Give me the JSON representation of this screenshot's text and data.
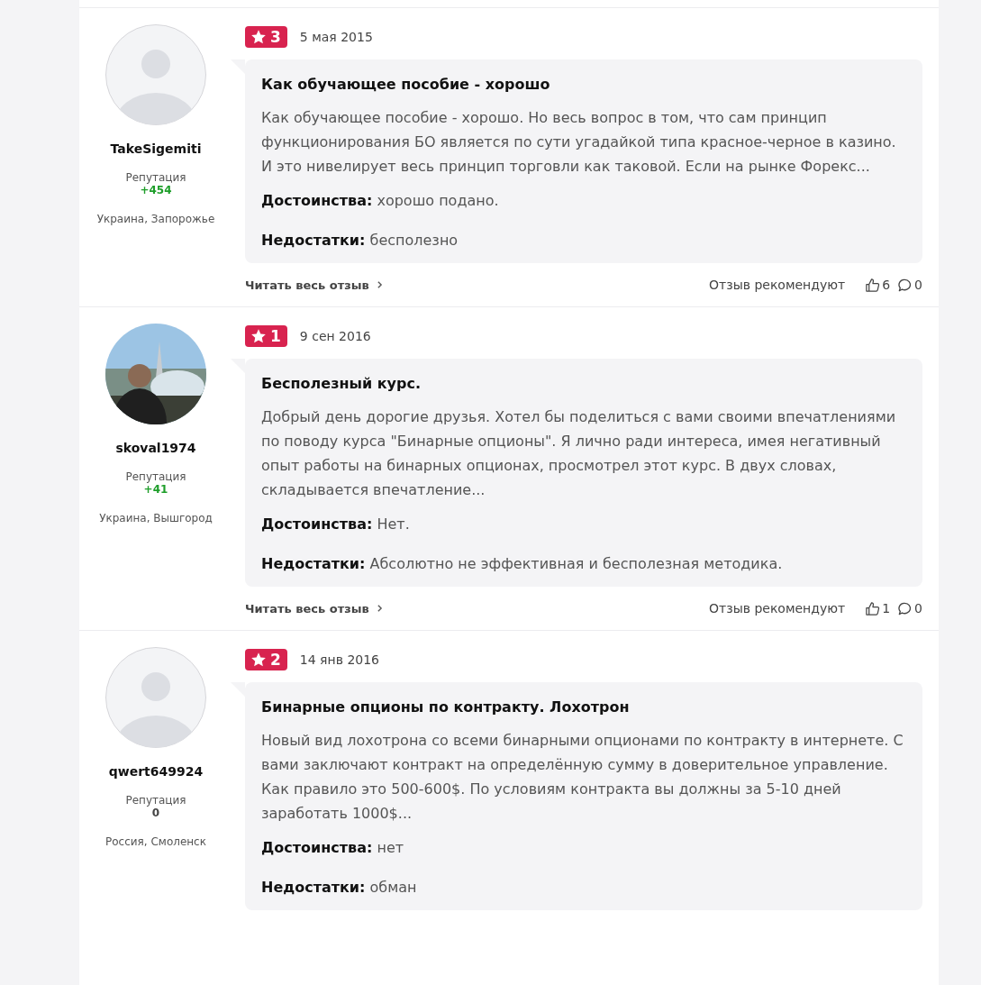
{
  "reviews": [
    {
      "author": {
        "name": "TakeSigemiti",
        "avatar": {
          "kind": "default"
        },
        "reputation_label": "Репутация",
        "reputation": "+454",
        "reputation_positive": true,
        "location": "Украина, Запорожье"
      },
      "rating": "3",
      "date": "5 мая 2015",
      "title": "Как обучающее пособие - хорошо",
      "text": "Как обучающее пособие - хорошо. Но весь вопрос в том, что сам принцип функционирования БО является по сути угадайкой типа красное-черное в казино. И это нивелирует весь принцип торговли как таковой. Если на рынке Форекс...",
      "pros_label": "Достоинства:",
      "pros": "хорошо подано.",
      "cons_label": "Недостатки:",
      "cons": "бесполезно",
      "footer": {
        "read_more": "Читать весь отзыв",
        "recommend": "Отзыв рекомендуют",
        "likes": "6",
        "comments": "0"
      }
    },
    {
      "author": {
        "name": "skoval1974",
        "reputation_label": "Репутация",
        "reputation": "+41",
        "reputation_positive": true,
        "location": "Украина, Вышгород"
      },
      "rating": "1",
      "date": "9 сен 2016",
      "title": "Бесполезный курс.",
      "text": "Добрый день дорогие друзья. Хотел бы поделиться с вами своими впечатлениями по поводу курса \"Бинарные опционы\". Я лично ради интереса, имея негативный опыт работы на бинарных опционах, просмотрел этот курс. В двух словах, складывается впечатление...",
      "pros_label": "Достоинства:",
      "pros": "Нет.",
      "cons_label": "Недостатки:",
      "cons": "Абсолютно не эффективная и бесполезная методика.",
      "footer": {
        "read_more": "Читать весь отзыв",
        "recommend": "Отзыв рекомендуют",
        "likes": "1",
        "comments": "0"
      }
    },
    {
      "author": {
        "name": "qwert649924",
        "avatar": {
          "kind": "default"
        },
        "reputation_label": "Репутация",
        "reputation": "0",
        "reputation_positive": false,
        "location": "Россия, Смоленск"
      },
      "rating": "2",
      "date": "14 янв 2016",
      "title": "Бинарные опционы по контракту. Лохотрон",
      "text": "Новый вид лохотрона со всеми бинарными опционами по контракту в интернете. С вами заключают контракт на определённую сумму в доверительное управление. Как правило это 500-600$. По условиям контракта вы должны за 5-10 дней заработать 1000$...",
      "pros_label": "Достоинства:",
      "pros": "нет",
      "cons_label": "Недостатки:",
      "cons": "обман"
    }
  ]
}
